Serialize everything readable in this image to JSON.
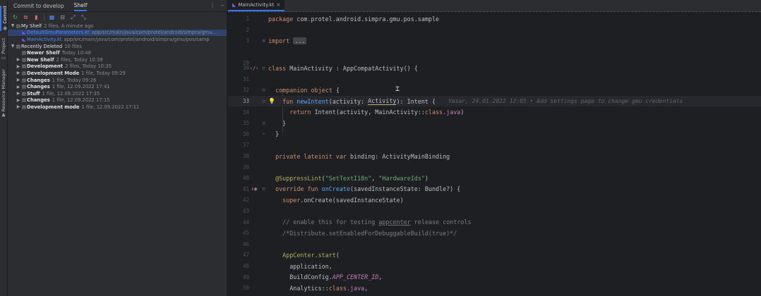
{
  "sidebar_strip": {
    "tabs": [
      {
        "label": "Commit",
        "icon": "commit-icon"
      },
      {
        "label": "Project",
        "icon": "folder-icon"
      },
      {
        "label": "Resource Manager",
        "icon": "resource-icon"
      }
    ]
  },
  "commit_panel": {
    "tabs": [
      "Commit to develop",
      "Shelf"
    ],
    "active_tab": "Shelf",
    "tree": {
      "my_shelf": {
        "name": "My Shelf",
        "meta": "2 files, A minute ago"
      },
      "my_shelf_files": [
        {
          "name": "DefaultGmuParameters.kt",
          "path": "app/src/main/java/com/protel/android/simpra/gmu..."
        },
        {
          "name": "MainActivity.kt",
          "path": "app/src/main/java/com/protel/android/simpra/gmu/pos/samp"
        }
      ],
      "recently_deleted": {
        "name": "Recently Deleted",
        "meta": "10 files"
      },
      "deleted_items": [
        {
          "name": "Newer Shelf",
          "meta": "Today 10:48"
        },
        {
          "name": "New Shelf",
          "meta": "2 files, Today 10:39"
        },
        {
          "name": "Development",
          "meta": "2 files, Today 10:35"
        },
        {
          "name": "Development Mode",
          "meta": "1 file, Today 09:29"
        },
        {
          "name": "Changes",
          "meta": "1 file, Today 09:26"
        },
        {
          "name": "Changes",
          "meta": "1 file, 12.09.2022 17:41"
        },
        {
          "name": "Stuff",
          "meta": "1 file, 12.09.2022 17:35"
        },
        {
          "name": "Changes",
          "meta": "1 file, 12.09.2022 17:15"
        },
        {
          "name": "Development mode",
          "meta": "1 file, 12.09.2022 17:11"
        }
      ]
    }
  },
  "editor": {
    "tab": {
      "name": "MainActivity.kt",
      "icon": "kotlin-file-icon"
    },
    "blame": "Yasar, 24.01.2022 12:05 • Add settings page to change gmu credentials",
    "lines": [
      {
        "n": "1"
      },
      {
        "n": "2"
      },
      {
        "n": "3"
      },
      {
        "n": "29"
      },
      {
        "n": "30"
      },
      {
        "n": "31"
      },
      {
        "n": "32"
      },
      {
        "n": "33"
      },
      {
        "n": "34"
      },
      {
        "n": "35"
      },
      {
        "n": "36"
      },
      {
        "n": "37"
      },
      {
        "n": "38"
      },
      {
        "n": "39"
      },
      {
        "n": "40"
      },
      {
        "n": "41"
      },
      {
        "n": "42"
      },
      {
        "n": "43"
      },
      {
        "n": "44"
      },
      {
        "n": "45"
      },
      {
        "n": "46"
      },
      {
        "n": "47"
      },
      {
        "n": "48"
      },
      {
        "n": "49"
      },
      {
        "n": "50"
      }
    ],
    "code": {
      "l1_kw": "package",
      "l1_pkg": " com.protel.android.simpra.gmu.pos.sample",
      "l3_kw": "import",
      "l3_fold": "...",
      "l30_kw": "class",
      "l30_name": " MainActivity",
      "l30_rest": " : AppCompatActivity() {",
      "l32_kw": "companion object",
      "l32_rest": " {",
      "l33_kw": "fun",
      "l33_fn": " newIntent",
      "l33_p1": "(activity: ",
      "l33_type": "Activity",
      "l33_p2": "): Intent {",
      "l34_kw": "return",
      "l34_rest": " Intent(activity, MainActivity::",
      "l34_kw2": "class",
      "l34_fld": ".java",
      "l34_end": ")",
      "l35": "}",
      "l36": "}",
      "l38_kw": "private lateinit var",
      "l38_rest": " binding: ActivityMainBinding",
      "l40_ann": "@SuppressLint",
      "l40_p": "(",
      "l40_s1": "\"SetTextI18n\"",
      "l40_c": ", ",
      "l40_s2": "\"HardwareIds\"",
      "l40_e": ")",
      "l41_kw": "override fun",
      "l41_fn": " onCreate",
      "l41_rest": "(savedInstanceState: Bundle?) {",
      "l42_kw": "super",
      "l42_rest": ".onCreate(savedInstanceState)",
      "l44_c1": "// enable this for testing ",
      "l44_u": "appcenter",
      "l44_c2": " release controls",
      "l45": "/*Distribute.setEnabledForDebuggableBuild(true)*/",
      "l47_fn": "AppCenter.start",
      "l47_rest": "(",
      "l48": "application,",
      "l49_a": "BuildConfig.",
      "l49_b": "APP_CENTER_ID",
      "l49_c": ",",
      "l50_a": "Analytics::",
      "l50_kw": "class",
      "l50_fld": ".java",
      "l50_c": ","
    }
  },
  "colors": {
    "accent": "#3574f0",
    "keyword": "#cf8e6d",
    "function": "#56a8f5",
    "string": "#6aab73",
    "annotation": "#b3ae60",
    "comment": "#7a7e85",
    "field": "#c77dbb"
  }
}
